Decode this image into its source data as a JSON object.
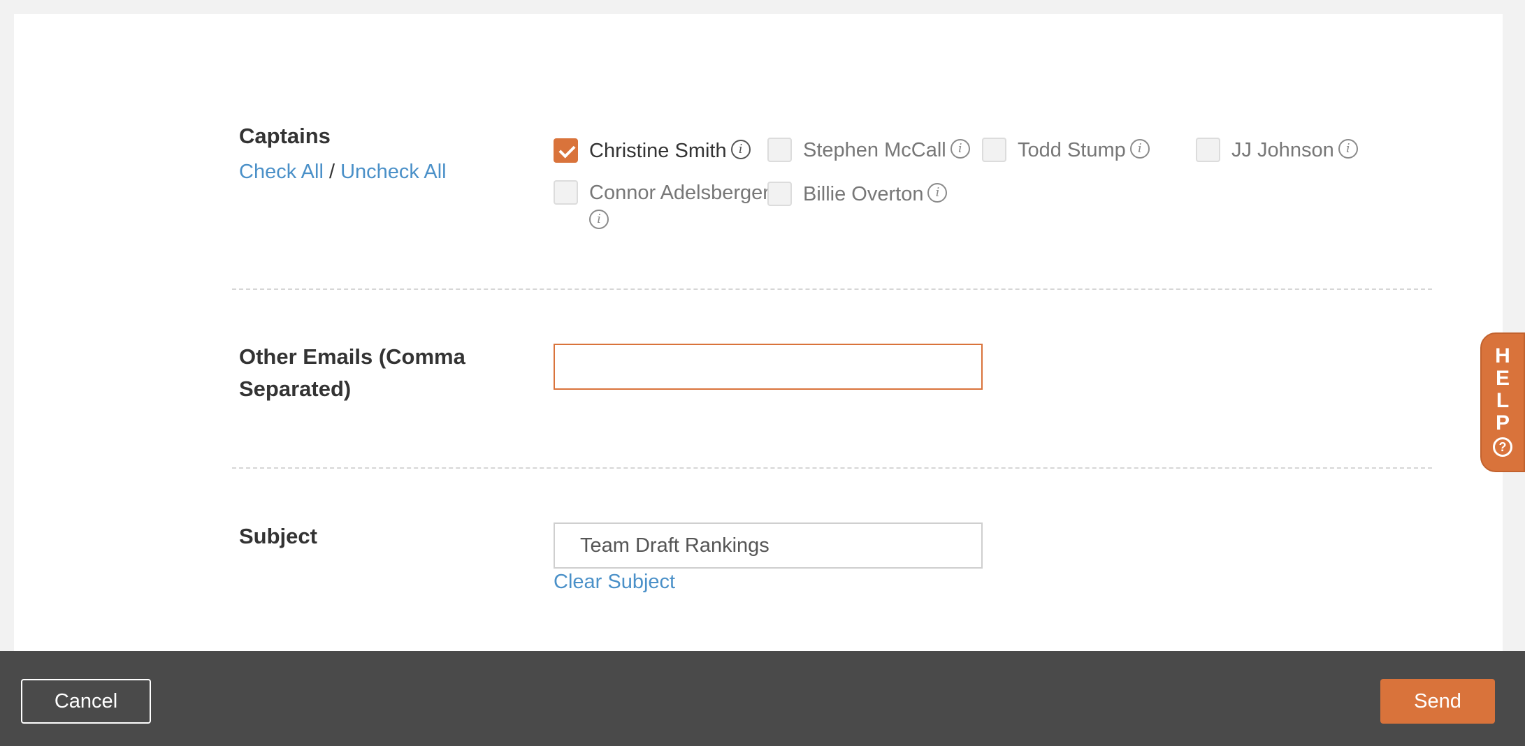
{
  "captains": {
    "label": "Captains",
    "check_all": "Check All",
    "separator": "/",
    "uncheck_all": "Uncheck All",
    "items": [
      {
        "name": "Christine Smith",
        "checked": true
      },
      {
        "name": "Stephen McCall",
        "checked": false
      },
      {
        "name": "Todd Stump",
        "checked": false
      },
      {
        "name": "JJ Johnson",
        "checked": false
      },
      {
        "name": "Connor Adelsberger",
        "checked": false
      },
      {
        "name": "Billie Overton",
        "checked": false
      }
    ],
    "info_glyph": "i"
  },
  "other_emails": {
    "label_line1": "Other Emails (Comma",
    "label_line2": "Separated)",
    "value": ""
  },
  "subject": {
    "label": "Subject",
    "value": "Team Draft Rankings",
    "clear_link": "Clear Subject"
  },
  "footer": {
    "cancel_label": "Cancel",
    "send_label": "Send"
  },
  "help_tab": {
    "letters": [
      "H",
      "E",
      "L",
      "P"
    ],
    "question_glyph": "?"
  },
  "colors": {
    "accent": "#d9733b",
    "link": "#4a90c8",
    "footer_bg": "#4a4a4a"
  }
}
